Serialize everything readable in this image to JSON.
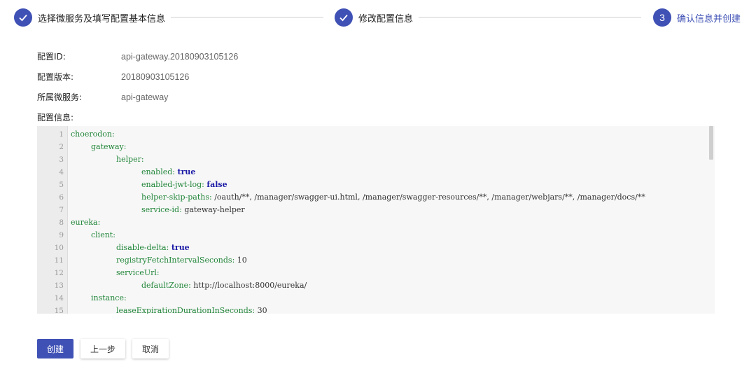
{
  "stepper": {
    "steps": [
      {
        "label": "选择微服务及填写配置基本信息",
        "state": "done"
      },
      {
        "label": "修改配置信息",
        "state": "done"
      },
      {
        "label": "确认信息并创建",
        "state": "active",
        "number": "3"
      }
    ],
    "accent_color": "#3f51b5"
  },
  "info": {
    "config_id_label": "配置ID:",
    "config_id_value": "api-gateway.20180903105126",
    "config_version_label": "配置版本:",
    "config_version_value": "20180903105126",
    "service_label": "所属微服务:",
    "service_value": "api-gateway",
    "config_info_label": "配置信息:"
  },
  "editor": {
    "lines": [
      {
        "num": "1",
        "indent": 0,
        "key": "choerodon:",
        "value": "",
        "value_type": ""
      },
      {
        "num": "2",
        "indent": 1,
        "key": "gateway:",
        "value": "",
        "value_type": ""
      },
      {
        "num": "3",
        "indent": 2,
        "key": "helper:",
        "value": "",
        "value_type": ""
      },
      {
        "num": "4",
        "indent": 3,
        "key": "enabled:",
        "value": "true",
        "value_type": "kw"
      },
      {
        "num": "5",
        "indent": 3,
        "key": "enabled-jwt-log:",
        "value": "false",
        "value_type": "kw"
      },
      {
        "num": "6",
        "indent": 3,
        "key": "helper-skip-paths:",
        "value": "/oauth/**, /manager/swagger-ui.html, /manager/swagger-resources/**, /manager/webjars/**, /manager/docs/**",
        "value_type": "val"
      },
      {
        "num": "7",
        "indent": 3,
        "key": "service-id:",
        "value": "gateway-helper",
        "value_type": "val"
      },
      {
        "num": "8",
        "indent": 0,
        "key": "eureka:",
        "value": "",
        "value_type": ""
      },
      {
        "num": "9",
        "indent": 1,
        "key": "client:",
        "value": "",
        "value_type": ""
      },
      {
        "num": "10",
        "indent": 2,
        "key": "disable-delta:",
        "value": "true",
        "value_type": "kw"
      },
      {
        "num": "11",
        "indent": 2,
        "key": "registryFetchIntervalSeconds:",
        "value": "10",
        "value_type": "val"
      },
      {
        "num": "12",
        "indent": 2,
        "key": "serviceUrl:",
        "value": "",
        "value_type": ""
      },
      {
        "num": "13",
        "indent": 3,
        "key": "defaultZone:",
        "value": "http://localhost:8000/eureka/",
        "value_type": "val"
      },
      {
        "num": "14",
        "indent": 1,
        "key": "instance:",
        "value": "",
        "value_type": ""
      },
      {
        "num": "15",
        "indent": 2,
        "key": "leaseExpirationDurationInSeconds:",
        "value": "30",
        "value_type": "val"
      }
    ]
  },
  "actions": {
    "create_label": "创建",
    "prev_label": "上一步",
    "cancel_label": "取消"
  }
}
